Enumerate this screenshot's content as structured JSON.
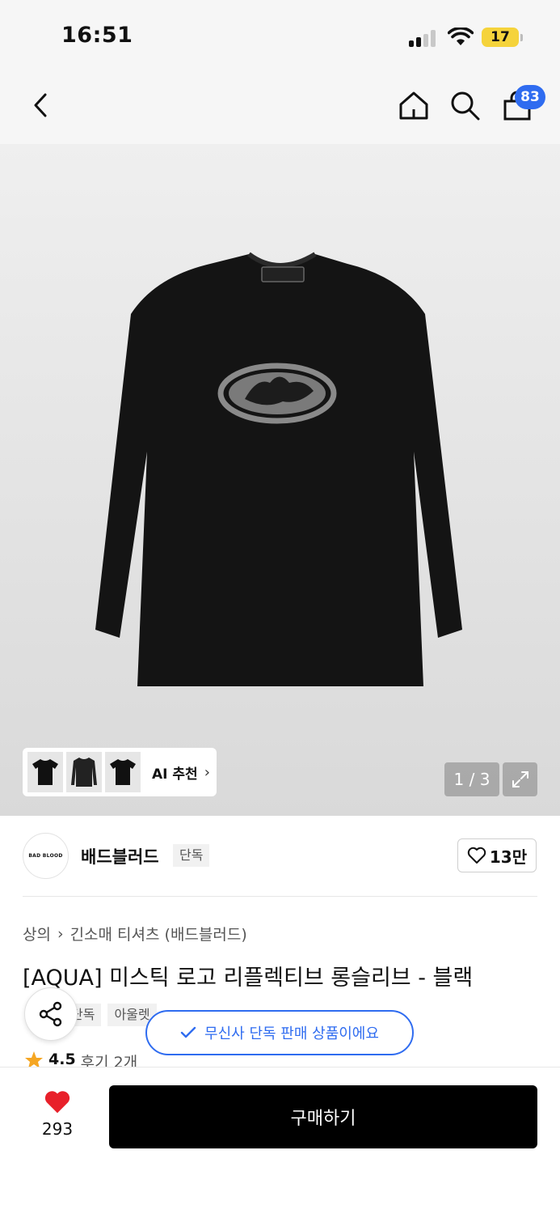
{
  "status_bar": {
    "time": "16:51",
    "battery": "17"
  },
  "nav": {
    "cart_count": "83"
  },
  "gallery": {
    "ai_label": "AI 추천",
    "pager": "1 / 3"
  },
  "brand": {
    "logo_text": "BAD BLOOD",
    "name": "배드블러드",
    "tag": "단독",
    "likes": "13만"
  },
  "product": {
    "breadcrumb": [
      "상의",
      "긴소매 티셔츠 (배드블러드)"
    ],
    "title": "[AQUA] 미스틱 로고 리플렉티브 롱슬리브 - 블랙",
    "tags": [
      "단독",
      "아울렛"
    ],
    "toast": "무신사 단독 판매 상품이에요",
    "rating": "4.5",
    "reviews": "후기 2개"
  },
  "bottom": {
    "heart_count": "293",
    "buy_label": "구매하기"
  },
  "colors": {
    "accent": "#2f6cf0",
    "heart": "#e8202a",
    "star": "#f5a623"
  },
  "icons": [
    "back-icon",
    "home-icon",
    "search-icon",
    "cart-icon",
    "expand-icon",
    "heart-outline-icon",
    "share-icon",
    "check-icon",
    "star-icon",
    "heart-icon",
    "chevron-right-icon"
  ]
}
